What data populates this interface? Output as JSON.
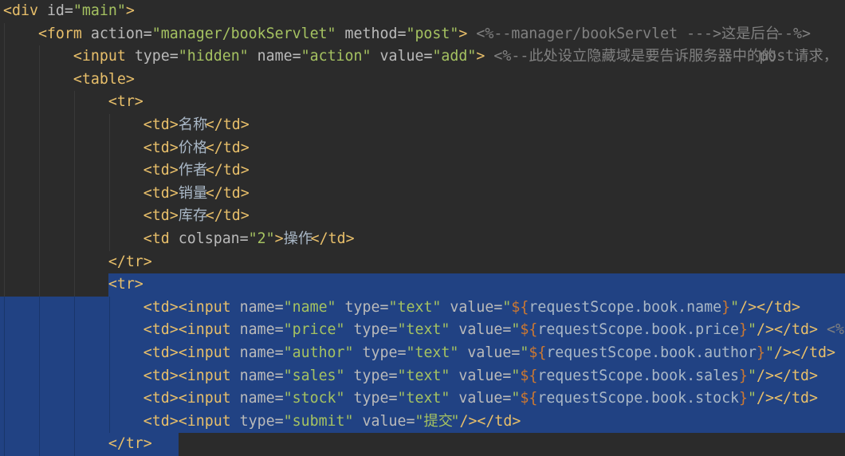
{
  "editor": {
    "theme": {
      "background": "#2B2B2B",
      "selection": "#214283",
      "tag": "#E8BF6A",
      "attr": "#BABABA",
      "value": "#A5C261",
      "comment": "#808080",
      "text": "#A9B7C6",
      "el": "#CC7832"
    },
    "selection": {
      "from_line": 13,
      "from_column": 13,
      "to_line": 20,
      "to_column": 21
    },
    "lines": [
      [
        {
          "tag": "<div"
        },
        {
          "attr": " id="
        },
        {
          "value": "\"main\""
        },
        {
          "tag": ">"
        }
      ],
      [
        {
          "tag": "    <form"
        },
        {
          "attr": " action="
        },
        {
          "value": "\"manager/bookServlet\""
        },
        {
          "attr": " method="
        },
        {
          "value": "\"post\""
        },
        {
          "tag": ">"
        },
        {
          "comment": " <%--manager/bookServlet --->"
        },
        {
          "comment": "这是后台"
        },
        {
          "comment": "--%>"
        }
      ],
      [
        {
          "tag": "        <input"
        },
        {
          "attr": " type="
        },
        {
          "value": "\"hidden\""
        },
        {
          "attr": " name="
        },
        {
          "value": "\"action\""
        },
        {
          "attr": " value="
        },
        {
          "value": "\"add\""
        },
        {
          "tag": ">"
        },
        {
          "comment": " <%--"
        },
        {
          "comment": "此处设立隐藏域是要告诉服务器中的的"
        },
        {
          "comment": "post"
        },
        {
          "comment": "请求，"
        }
      ],
      [
        {
          "tag": "        <table>"
        }
      ],
      [
        {
          "tag": "            <tr>"
        }
      ],
      [
        {
          "tag": "                <td>"
        },
        {
          "text": "名称"
        },
        {
          "tag": "</td>"
        }
      ],
      [
        {
          "tag": "                <td>"
        },
        {
          "text": "价格"
        },
        {
          "tag": "</td>"
        }
      ],
      [
        {
          "tag": "                <td>"
        },
        {
          "text": "作者"
        },
        {
          "tag": "</td>"
        }
      ],
      [
        {
          "tag": "                <td>"
        },
        {
          "text": "销量"
        },
        {
          "tag": "</td>"
        }
      ],
      [
        {
          "tag": "                <td>"
        },
        {
          "text": "库存"
        },
        {
          "tag": "</td>"
        }
      ],
      [
        {
          "tag": "                <td"
        },
        {
          "attr": " colspan="
        },
        {
          "value": "\"2\""
        },
        {
          "tag": ">"
        },
        {
          "text": "操作"
        },
        {
          "tag": "</td>"
        }
      ],
      [
        {
          "tag": "            </tr>"
        }
      ],
      [
        {
          "tag": "            <tr>"
        }
      ],
      [
        {
          "tag": "                <td><input"
        },
        {
          "attr": " name="
        },
        {
          "value": "\"name\""
        },
        {
          "attr": " type="
        },
        {
          "value": "\"text\""
        },
        {
          "attr": " value="
        },
        {
          "value": "\""
        },
        {
          "el": "${"
        },
        {
          "text": "requestScope.book.name"
        },
        {
          "el": "}"
        },
        {
          "value": "\""
        },
        {
          "tag": "/></td>"
        }
      ],
      [
        {
          "tag": "                <td><input"
        },
        {
          "attr": " name="
        },
        {
          "value": "\"price\""
        },
        {
          "attr": " type="
        },
        {
          "value": "\"text\""
        },
        {
          "attr": " value="
        },
        {
          "value": "\""
        },
        {
          "el": "${"
        },
        {
          "text": "requestScope.book.price"
        },
        {
          "el": "}"
        },
        {
          "value": "\""
        },
        {
          "tag": "/></td>"
        },
        {
          "comment": " <%"
        }
      ],
      [
        {
          "tag": "                <td><input"
        },
        {
          "attr": " name="
        },
        {
          "value": "\"author\""
        },
        {
          "attr": " type="
        },
        {
          "value": "\"text\""
        },
        {
          "attr": " value="
        },
        {
          "value": "\""
        },
        {
          "el": "${"
        },
        {
          "text": "requestScope.book.author"
        },
        {
          "el": "}"
        },
        {
          "value": "\""
        },
        {
          "tag": "/></td>"
        }
      ],
      [
        {
          "tag": "                <td><input"
        },
        {
          "attr": " name="
        },
        {
          "value": "\"sales\""
        },
        {
          "attr": " type="
        },
        {
          "value": "\"text\""
        },
        {
          "attr": " value="
        },
        {
          "value": "\""
        },
        {
          "el": "${"
        },
        {
          "text": "requestScope.book.sales"
        },
        {
          "el": "}"
        },
        {
          "value": "\""
        },
        {
          "tag": "/></td>"
        }
      ],
      [
        {
          "tag": "                <td><input"
        },
        {
          "attr": " name="
        },
        {
          "value": "\"stock\""
        },
        {
          "attr": " type="
        },
        {
          "value": "\"text\""
        },
        {
          "attr": " value="
        },
        {
          "value": "\""
        },
        {
          "el": "${"
        },
        {
          "text": "requestScope.book.stock"
        },
        {
          "el": "}"
        },
        {
          "value": "\""
        },
        {
          "tag": "/></td>"
        }
      ],
      [
        {
          "tag": "                <td><input"
        },
        {
          "attr": " type="
        },
        {
          "value": "\"submit\""
        },
        {
          "attr": " value="
        },
        {
          "value": "\""
        },
        {
          "value": "提交"
        },
        {
          "value": "\""
        },
        {
          "tag": "/></td>"
        }
      ],
      [
        {
          "tag": "            </tr>"
        }
      ]
    ]
  }
}
